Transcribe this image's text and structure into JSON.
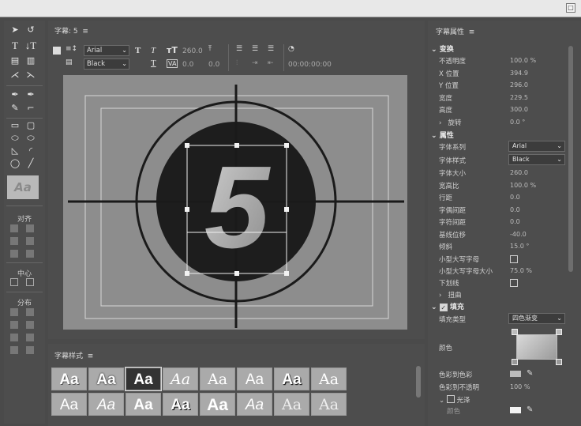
{
  "window": {
    "maximize_label": "□"
  },
  "tools": {
    "align_label": "对齐",
    "center_label": "中心",
    "distribute_label": "分布",
    "preview_text": "Aa"
  },
  "title_panel": {
    "tab_label": "字幕: 5",
    "menu_icon": "≡",
    "font_family": "Arial",
    "font_style": "Black",
    "font_size": "260.0",
    "kerning": "0.0",
    "tracking": "0.0",
    "timecode": "00:00:00:00",
    "big_number": "5"
  },
  "styles_panel": {
    "tab_label": "字幕样式",
    "menu_icon": "≡",
    "swatch_text": "Aa",
    "swatch_count": 16
  },
  "properties": {
    "tab_label": "字幕属性",
    "menu_icon": "≡",
    "transform": {
      "header": "变换",
      "rows": [
        {
          "label": "不透明度",
          "value": "100.0 %"
        },
        {
          "label": "X 位置",
          "value": "394.9"
        },
        {
          "label": "Y 位置",
          "value": "296.0"
        },
        {
          "label": "宽度",
          "value": "229.5"
        },
        {
          "label": "高度",
          "value": "300.0"
        }
      ],
      "rotation": {
        "label": "旋转",
        "value": "0.0 °"
      }
    },
    "attributes": {
      "header": "属性",
      "font_family_label": "字体系列",
      "font_family": "Arial",
      "font_style_label": "字体样式",
      "font_style": "Black",
      "rows": [
        {
          "label": "字体大小",
          "value": "260.0"
        },
        {
          "label": "宽高比",
          "value": "100.0 %"
        },
        {
          "label": "行距",
          "value": "0.0"
        },
        {
          "label": "字偶间距",
          "value": "0.0"
        },
        {
          "label": "字符间距",
          "value": "0.0"
        },
        {
          "label": "基线位移",
          "value": "-40.0"
        },
        {
          "label": "倾斜",
          "value": "15.0 °"
        }
      ],
      "small_caps_label": "小型大写字母",
      "small_caps_size_label": "小型大写字母大小",
      "small_caps_size": "75.0 %",
      "underline_label": "下划线",
      "distort_label": "扭曲"
    },
    "fill": {
      "header": "填充",
      "fill_type_label": "填充类型",
      "fill_type": "四色渐变",
      "color_label": "颜色",
      "color_stop_label": "色彩到色彩",
      "color_opacity_label": "色彩到不透明",
      "color_opacity": "100 %",
      "sheen_label": "光泽",
      "sheen_color_label": "颜色"
    }
  }
}
